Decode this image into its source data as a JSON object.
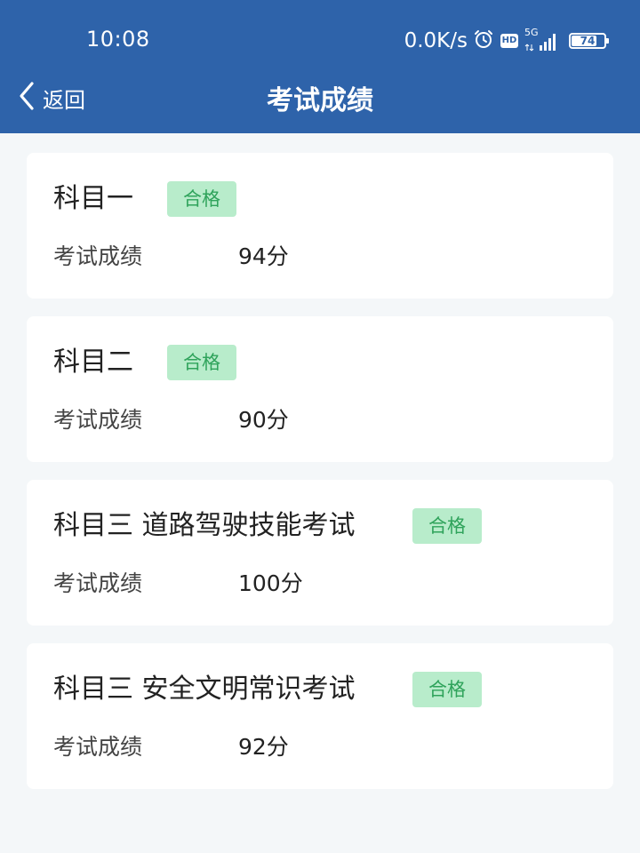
{
  "status_bar": {
    "time": "10:08",
    "net_speed": "0.0K/s",
    "network": "5G",
    "battery": "74",
    "icons": [
      "alarm-icon",
      "hd-icon",
      "signal-icon",
      "battery-icon"
    ]
  },
  "nav": {
    "back_label": "返回",
    "title": "考试成绩"
  },
  "colors": {
    "header_bg": "#2e63aa",
    "page_bg": "#f4f7f9",
    "badge_bg": "#b8eccb",
    "badge_text": "#2fa35b"
  },
  "results": [
    {
      "subject": "科目一",
      "status": "合格",
      "score_label": "考试成绩",
      "score": "94分"
    },
    {
      "subject": "科目二",
      "status": "合格",
      "score_label": "考试成绩",
      "score": "90分"
    },
    {
      "subject": "科目三 道路驾驶技能考试",
      "status": "合格",
      "score_label": "考试成绩",
      "score": "100分"
    },
    {
      "subject": "科目三 安全文明常识考试",
      "status": "合格",
      "score_label": "考试成绩",
      "score": "92分"
    }
  ]
}
